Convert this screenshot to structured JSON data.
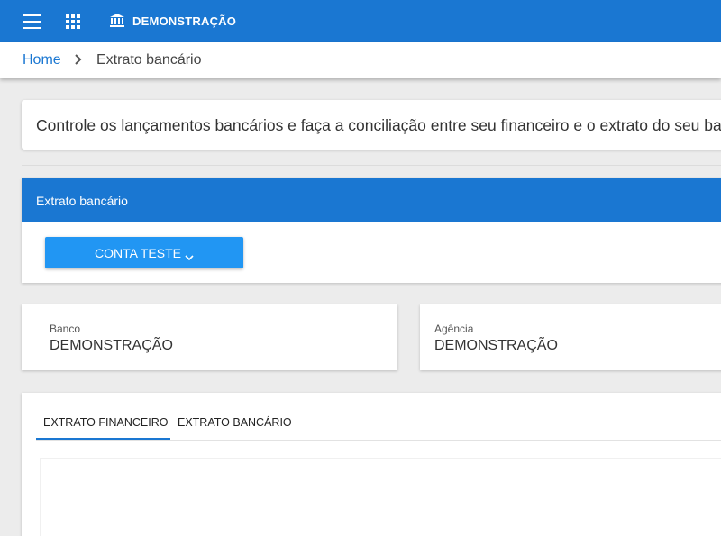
{
  "header": {
    "brand": "DEMONSTRAÇÃO",
    "icons": [
      "menu-icon",
      "apps-icon",
      "bank-icon"
    ],
    "accent_color": "#1a77d2"
  },
  "breadcrumb": {
    "home": "Home",
    "current": "Extrato bancário"
  },
  "description": "Controle os lançamentos bancários e faça a conciliação entre seu financeiro e o extrato do seu banco.",
  "extrato": {
    "title": "Extrato bancário",
    "account_button": "CONTA TESTE",
    "button_color": "#2196f3"
  },
  "info": {
    "banco_label": "Banco",
    "banco_value": "DEMONSTRAÇÃO",
    "agencia_label": "Agência",
    "agencia_value": "DEMONSTRAÇÃO"
  },
  "tabs": {
    "items": [
      "EXTRATO FINANCEIRO",
      "EXTRATO BANCÁRIO"
    ],
    "active": "EXTRATO FINANCEIRO"
  }
}
